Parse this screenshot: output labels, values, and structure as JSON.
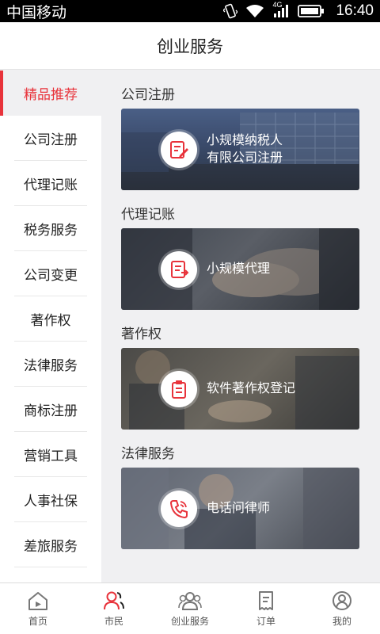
{
  "status_bar": {
    "carrier": "中国移动",
    "network": "4G",
    "time": "16:40"
  },
  "header": {
    "title": "创业服务"
  },
  "sidebar": {
    "items": [
      {
        "label": "精品推荐",
        "active": true
      },
      {
        "label": "公司注册"
      },
      {
        "label": "代理记账"
      },
      {
        "label": "税务服务"
      },
      {
        "label": "公司变更"
      },
      {
        "label": "著作权"
      },
      {
        "label": "法律服务"
      },
      {
        "label": "商标注册"
      },
      {
        "label": "营销工具"
      },
      {
        "label": "人事社保"
      },
      {
        "label": "差旅服务"
      }
    ]
  },
  "sections": [
    {
      "title": "公司注册",
      "card": {
        "line1": "小规模纳税人",
        "line2": "有限公司注册",
        "icon": "edit-document-icon"
      }
    },
    {
      "title": "代理记账",
      "card": {
        "line1": "小规模代理",
        "line2": "",
        "icon": "ledger-icon"
      }
    },
    {
      "title": "著作权",
      "card": {
        "line1": "软件著作权登记",
        "line2": "",
        "icon": "clipboard-icon"
      }
    },
    {
      "title": "法律服务",
      "card": {
        "line1": "电话问律师",
        "line2": "",
        "icon": "phone-icon"
      }
    }
  ],
  "tabbar": {
    "tabs": [
      {
        "label": "首页",
        "icon": "home-icon"
      },
      {
        "label": "市民",
        "icon": "citizen-icon",
        "active": true
      },
      {
        "label": "创业服务",
        "icon": "group-icon"
      },
      {
        "label": "订单",
        "icon": "order-icon"
      },
      {
        "label": "我的",
        "icon": "profile-icon"
      }
    ]
  },
  "colors": {
    "accent": "#e8333b"
  }
}
